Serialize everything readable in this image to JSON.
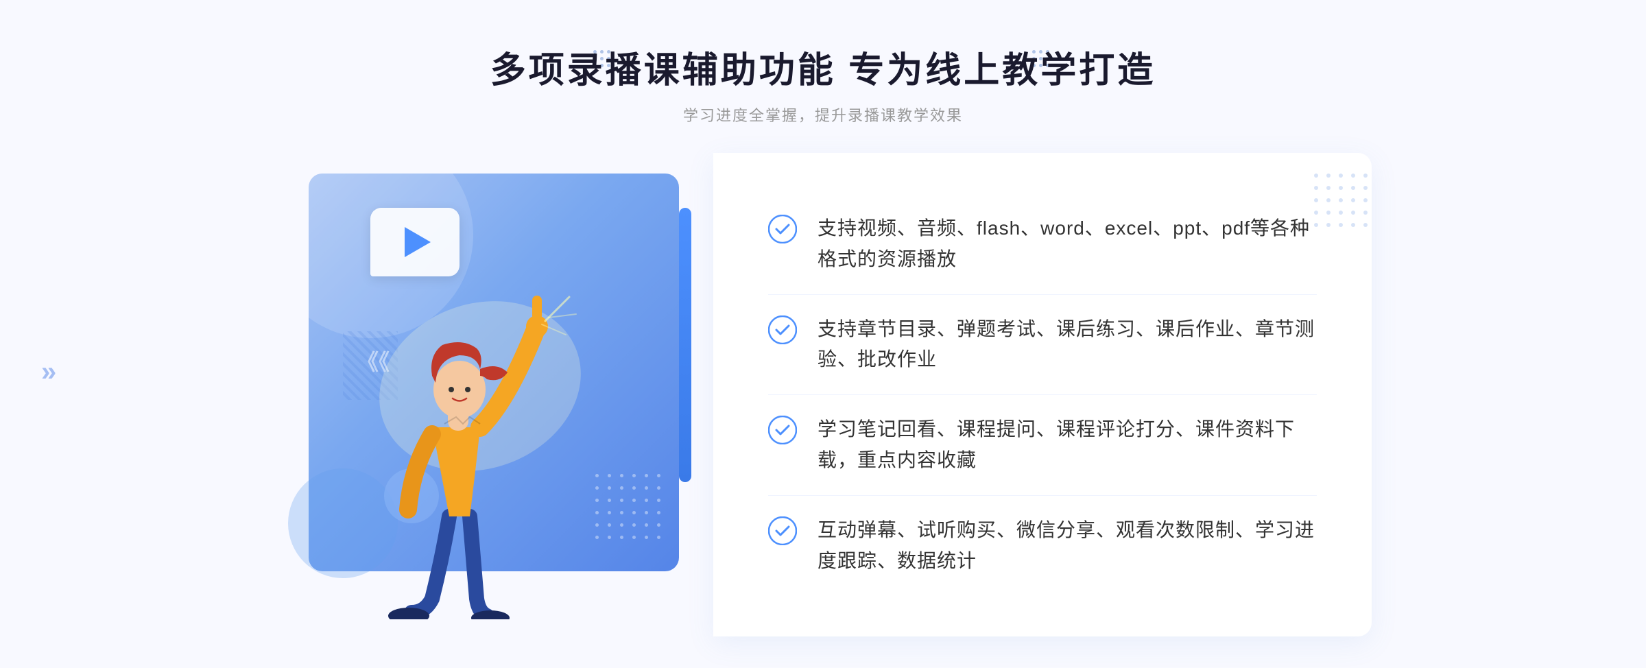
{
  "header": {
    "main_title": "多项录播课辅助功能 专为线上教学打造",
    "sub_title": "学习进度全掌握，提升录播课教学效果"
  },
  "features": [
    {
      "id": "feature-1",
      "text": "支持视频、音频、flash、word、excel、ppt、pdf等各种格式的资源播放"
    },
    {
      "id": "feature-2",
      "text": "支持章节目录、弹题考试、课后练习、课后作业、章节测验、批改作业"
    },
    {
      "id": "feature-3",
      "text": "学习笔记回看、课程提问、课程评论打分、课件资料下载，重点内容收藏"
    },
    {
      "id": "feature-4",
      "text": "互动弹幕、试听购买、微信分享、观看次数限制、学习进度跟踪、数据统计"
    }
  ],
  "decoration": {
    "arrow_left": "»",
    "arrow_left2": "»"
  }
}
